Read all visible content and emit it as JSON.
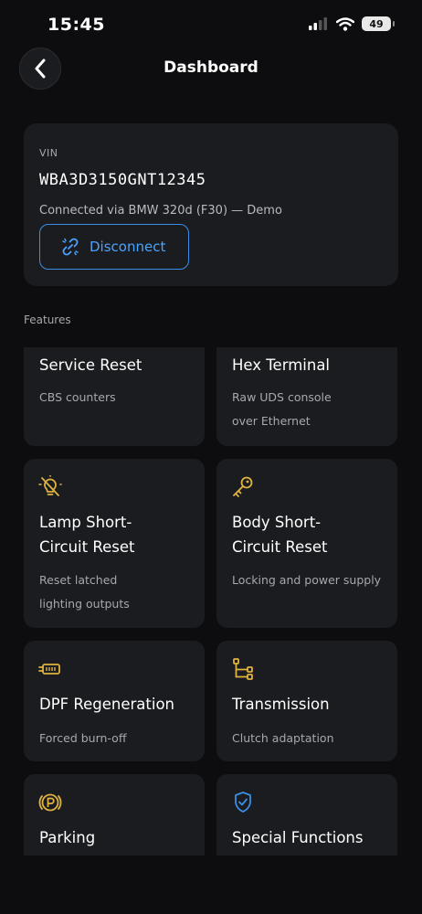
{
  "status_bar": {
    "time": "15:45",
    "battery": "49"
  },
  "nav": {
    "title": "Dashboard"
  },
  "vin_card": {
    "label": "VIN",
    "value": "WBA3D3150GNT12345",
    "connection": "Connected via BMW 320d (F30) — Demo",
    "disconnect_label": "Disconnect"
  },
  "section_label": "Features",
  "features": [
    {
      "title": "Service Reset",
      "subtitle": "CBS counters",
      "icon": "none"
    },
    {
      "title": "Hex Terminal",
      "subtitle": "Raw UDS console over Ethernet",
      "icon": "none"
    },
    {
      "title": "Lamp Short-Circuit Reset",
      "subtitle": "Reset latched lighting outputs",
      "icon": "bulb-off-icon"
    },
    {
      "title": "Body Short-Circuit Reset",
      "subtitle": "Locking and power supply",
      "icon": "key-icon"
    },
    {
      "title": "DPF Regeneration",
      "subtitle": "Forced burn-off",
      "icon": "dpf-icon"
    },
    {
      "title": "Transmission",
      "subtitle": "Clutch adaptation",
      "icon": "branch-icon"
    },
    {
      "title": "Parking",
      "subtitle": "",
      "icon": "parking-brake-icon"
    },
    {
      "title": "Special Functions",
      "subtitle": "",
      "icon": "shield-check-icon"
    }
  ],
  "colors": {
    "background": "#0d0d0f",
    "card": "#1b1c20",
    "accent_blue": "#4aa3ff",
    "accent_gold": "#e0b340"
  }
}
